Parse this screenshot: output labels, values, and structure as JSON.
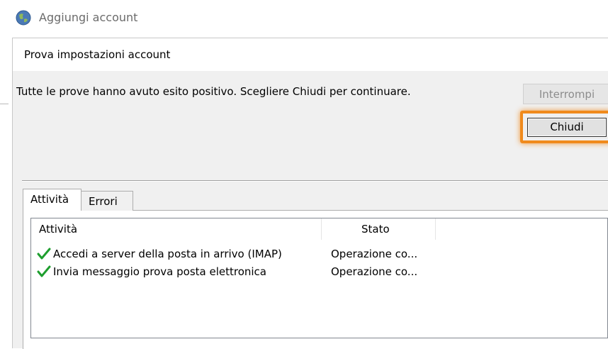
{
  "window": {
    "title": "Aggiungi account",
    "icon": "outlook-globe-icon"
  },
  "dialog": {
    "title": "Prova impostazioni account",
    "message": "Tutte le prove hanno avuto esito positivo. Scegliere Chiudi per continuare."
  },
  "buttons": {
    "stop_label": "Interrompi",
    "close_label": "Chiudi"
  },
  "tabs": [
    {
      "label": "Attività",
      "active": true
    },
    {
      "label": "Errori",
      "active": false
    }
  ],
  "list": {
    "columns": {
      "activity": "Attività",
      "status": "Stato"
    },
    "rows": [
      {
        "icon": "checkmark-icon",
        "activity": "Accedi a server della posta in arrivo (IMAP)",
        "status": "Operazione co..."
      },
      {
        "icon": "checkmark-icon",
        "activity": "Invia messaggio prova posta elettronica",
        "status": "Operazione co..."
      }
    ]
  },
  "colors": {
    "highlight": "#f08a1c",
    "check": "#1e9e2e"
  }
}
